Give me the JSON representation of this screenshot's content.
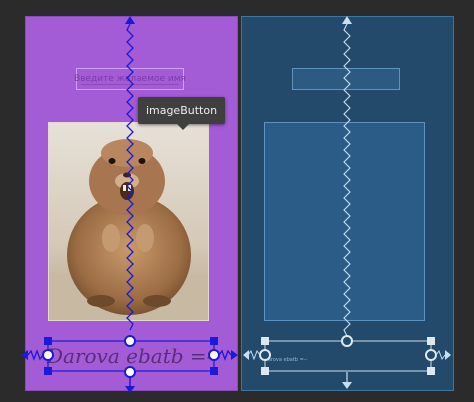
{
  "design": {
    "input_placeholder": "Введите желаемое имя",
    "image_button_tooltip": "imageButton",
    "bottom_text": "Darova ebatb =--"
  },
  "blueprint": {
    "bottom_text": "Darova ebatb =--"
  },
  "colors": {
    "background": "#2b2b2b",
    "design_surface": "#a45bd6",
    "blueprint_surface": "#244a6b",
    "constraint": "#1a1ad8",
    "blueprint_line": "#c7dff2"
  },
  "icons": {
    "image_content": "groundhog-photo",
    "handles": "constraint-handle-icon",
    "arrows": "constraint-arrow-icon"
  }
}
